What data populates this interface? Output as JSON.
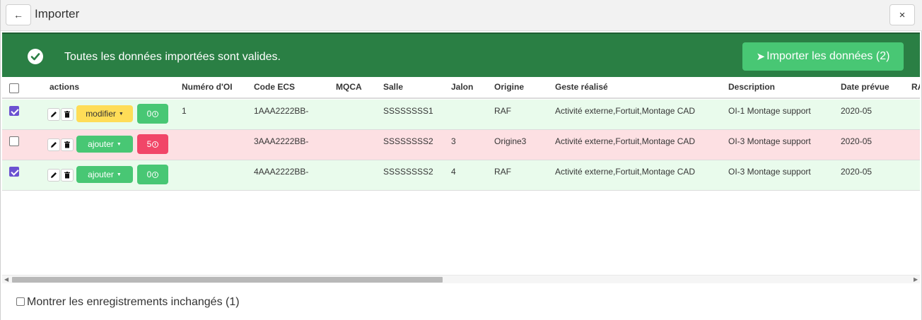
{
  "window": {
    "title": "Importer",
    "back_icon": "←",
    "close_icon": "×"
  },
  "banner": {
    "message": "Toutes les données importées sont valides.",
    "import_button": "Importer les données (2)",
    "color": "#2a7f44"
  },
  "table": {
    "columns": [
      "actions",
      "Numéro d'OI",
      "Code ECS",
      "MQCA",
      "Salle",
      "Jalon",
      "Origine",
      "Geste réalisé",
      "Description",
      "Date prévue",
      "RA"
    ],
    "rows": [
      {
        "checked": true,
        "status": "valid",
        "action": "modifier",
        "count": "0",
        "numero_oi": "1",
        "code_ecs": "1AAA2222BB-",
        "mqca": "",
        "salle": "SSSSSSSS1",
        "jalon": "",
        "origine": "RAF",
        "geste": "Activité externe,Fortuit,Montage CAD",
        "description": "OI-1 Montage support",
        "date_prevue": "2020-05"
      },
      {
        "checked": false,
        "status": "error",
        "action": "ajouter",
        "count": "5",
        "numero_oi": "",
        "code_ecs": "3AAA2222BB-",
        "mqca": "",
        "salle": "SSSSSSSS2",
        "jalon": "3",
        "origine": "Origine3",
        "geste": "Activité externe,Fortuit,Montage CAD",
        "description": "OI-3 Montage support",
        "date_prevue": "2020-05"
      },
      {
        "checked": true,
        "status": "valid",
        "action": "ajouter",
        "count": "0",
        "numero_oi": "",
        "code_ecs": "4AAA2222BB-",
        "mqca": "",
        "salle": "SSSSSSSS2",
        "jalon": "4",
        "origine": "RAF",
        "geste": "Activité externe,Fortuit,Montage CAD",
        "description": "OI-3 Montage support",
        "date_prevue": "2020-05"
      }
    ]
  },
  "footer": {
    "show_unchanged_label": "Montrer les enregistrements inchangés (1)",
    "show_unchanged_checked": false
  }
}
